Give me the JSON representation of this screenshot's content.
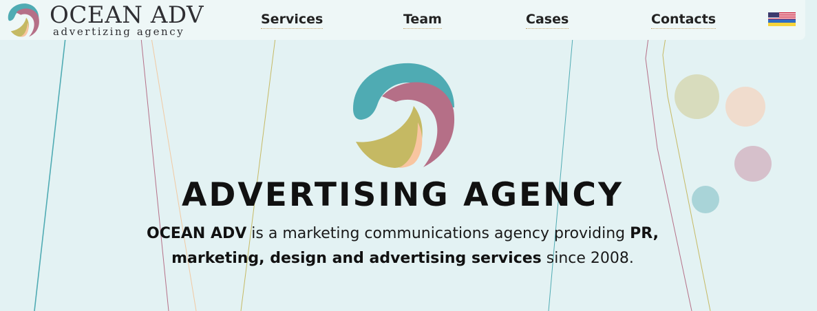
{
  "header": {
    "brand_name": "OCEAN ADV",
    "brand_tagline": "advertizing agency",
    "nav": [
      "Services",
      "Team",
      "Cases",
      "Contacts"
    ],
    "language_flag_icon": "us-ua-flag-icon"
  },
  "hero": {
    "title": "ADVERTISING AGENCY",
    "desc_brand": "OCEAN ADV",
    "desc_part1": " is a marketing communications agency providing ",
    "desc_bold": "PR, marketing, design and advertising services",
    "desc_part2": " since 2008."
  },
  "colors": {
    "background": "#e3f2f3",
    "teal": "#4fabb3",
    "mauve": "#b56f87",
    "olive": "#c5b963",
    "peach": "#f8c5a0",
    "nav_underline": "#c9a66b"
  }
}
